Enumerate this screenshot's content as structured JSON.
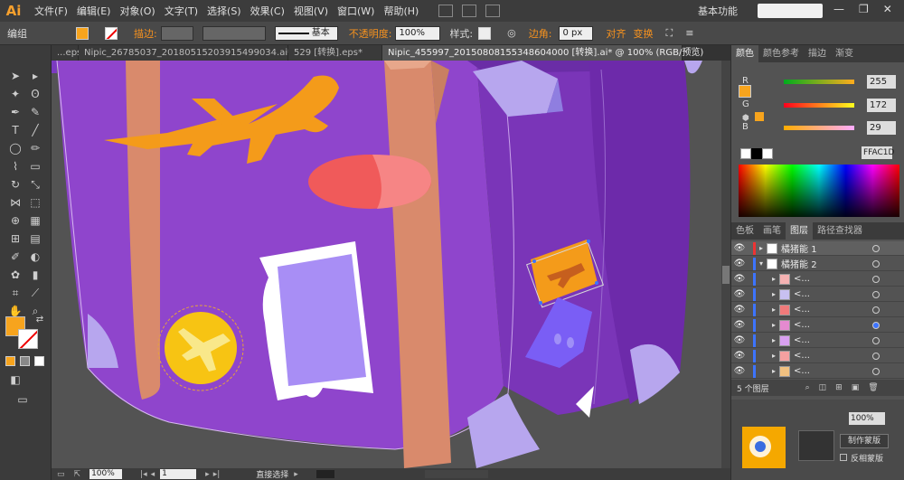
{
  "app": {
    "logo": "Ai"
  },
  "menu": [
    "文件(F)",
    "编辑(E)",
    "对象(O)",
    "文字(T)",
    "选择(S)",
    "效果(C)",
    "视图(V)",
    "窗口(W)",
    "帮助(H)"
  ],
  "workspace": "基本功能",
  "control_bar": {
    "selection_label": "编组",
    "stroke_label": "描边:",
    "stroke_style": "基本",
    "opacity_label": "不透明度:",
    "opacity_value": "100%",
    "style_label": "样式:",
    "corner_label": "边角:",
    "corner_value": "0 px",
    "align_label": "对齐",
    "transform_label": "变换"
  },
  "tabs": [
    {
      "label": "...eps*"
    },
    {
      "label": "Nipic_26785037_20180515203915499034.ai*"
    },
    {
      "label": "529 [转换].eps*"
    },
    {
      "label": "Nipic_455997_20150808155348604000 [转换].ai* @ 100% (RGB/预览)"
    }
  ],
  "color_panel": {
    "tabs": [
      "颜色",
      "颜色参考",
      "描边",
      "渐变"
    ],
    "r_label": "R",
    "r_value": "255",
    "g_label": "G",
    "g_value": "172",
    "b_label": "B",
    "b_value": "29",
    "hex_value": "FFAC1D"
  },
  "layers_panel": {
    "tabs": [
      "色板",
      "画笔",
      "图层",
      "路径查找器"
    ],
    "layers": [
      {
        "name": "橘猪能 1",
        "selected": true
      },
      {
        "name": "橘猪能 2",
        "selected": false
      },
      {
        "name": "<...",
        "selected": false
      },
      {
        "name": "<...",
        "selected": false
      },
      {
        "name": "<...",
        "selected": false
      },
      {
        "name": "<...",
        "selected": false
      },
      {
        "name": "<...",
        "selected": false
      },
      {
        "name": "<...",
        "selected": false
      },
      {
        "name": "<...",
        "selected": false
      }
    ],
    "layer_count": "5 个图层",
    "opacity_value": "100%",
    "mask_button": "制作蒙版",
    "invert_mask": "反相蒙版"
  },
  "status": {
    "zoom": "100%",
    "page": "1",
    "tool_name": "直接选择"
  },
  "colors": {
    "fill": "#FFAC1D",
    "suitcase": "#8e42c9",
    "strap": "#d98a6c",
    "airplane": "#f49b1a",
    "accent_red": "#f05a5a"
  }
}
